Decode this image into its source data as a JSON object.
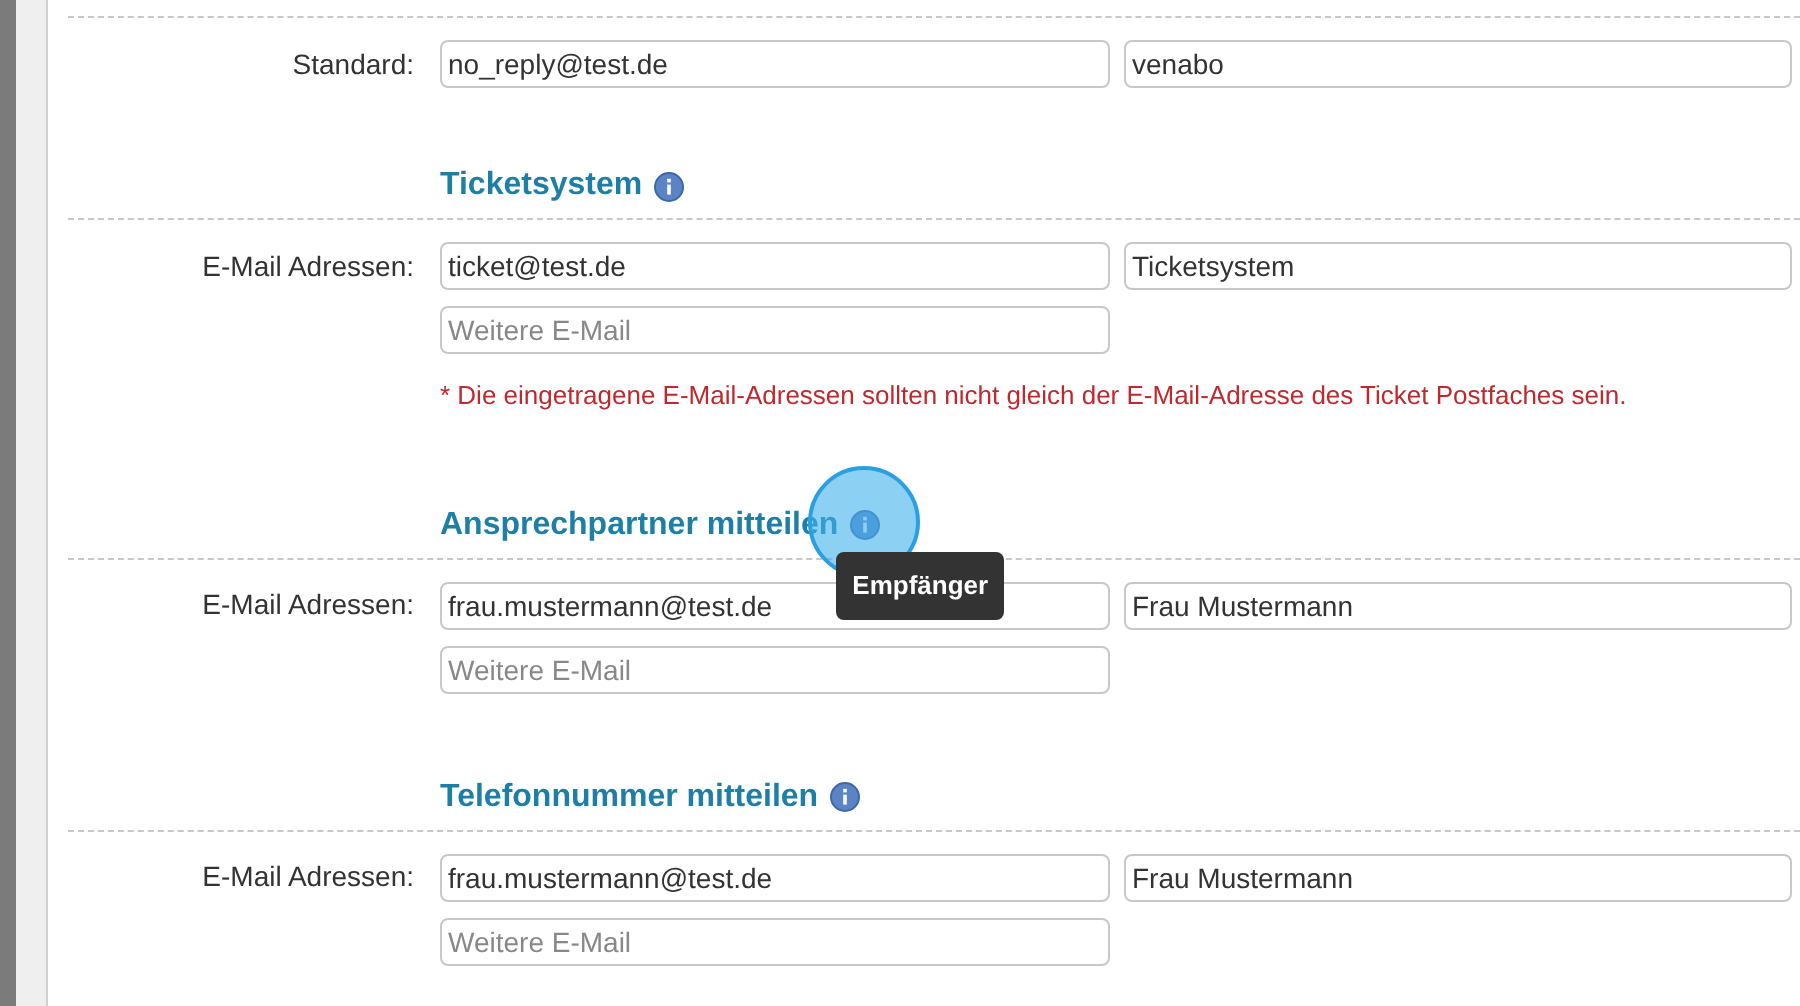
{
  "sections": [
    {
      "rows": [
        {
          "label": "Standard:",
          "email": "no_reply@test.de",
          "name": "venabo"
        }
      ]
    },
    {
      "heading": "Ticketsystem",
      "rows": [
        {
          "label": "E-Mail Adressen:",
          "email": "ticket@test.de",
          "name": "Ticketsystem"
        }
      ],
      "extra_placeholder": "Weitere E-Mail",
      "note": "* Die eingetragene E-Mail-Adressen sollten nicht gleich der E-Mail-Adresse des Ticket Postfaches sein."
    },
    {
      "heading": "Ansprechpartner mitteilen",
      "tooltip": "Empfänger",
      "rows": [
        {
          "label": "E-Mail Adressen:",
          "email": "frau.mustermann@test.de",
          "name": "Frau Mustermann"
        }
      ],
      "extra_placeholder": "Weitere E-Mail"
    },
    {
      "heading": "Telefonnummer mitteilen",
      "rows": [
        {
          "label": "E-Mail Adressen:",
          "email": "frau.mustermann@test.de",
          "name": "Frau Mustermann"
        }
      ],
      "extra_placeholder": "Weitere E-Mail"
    }
  ]
}
